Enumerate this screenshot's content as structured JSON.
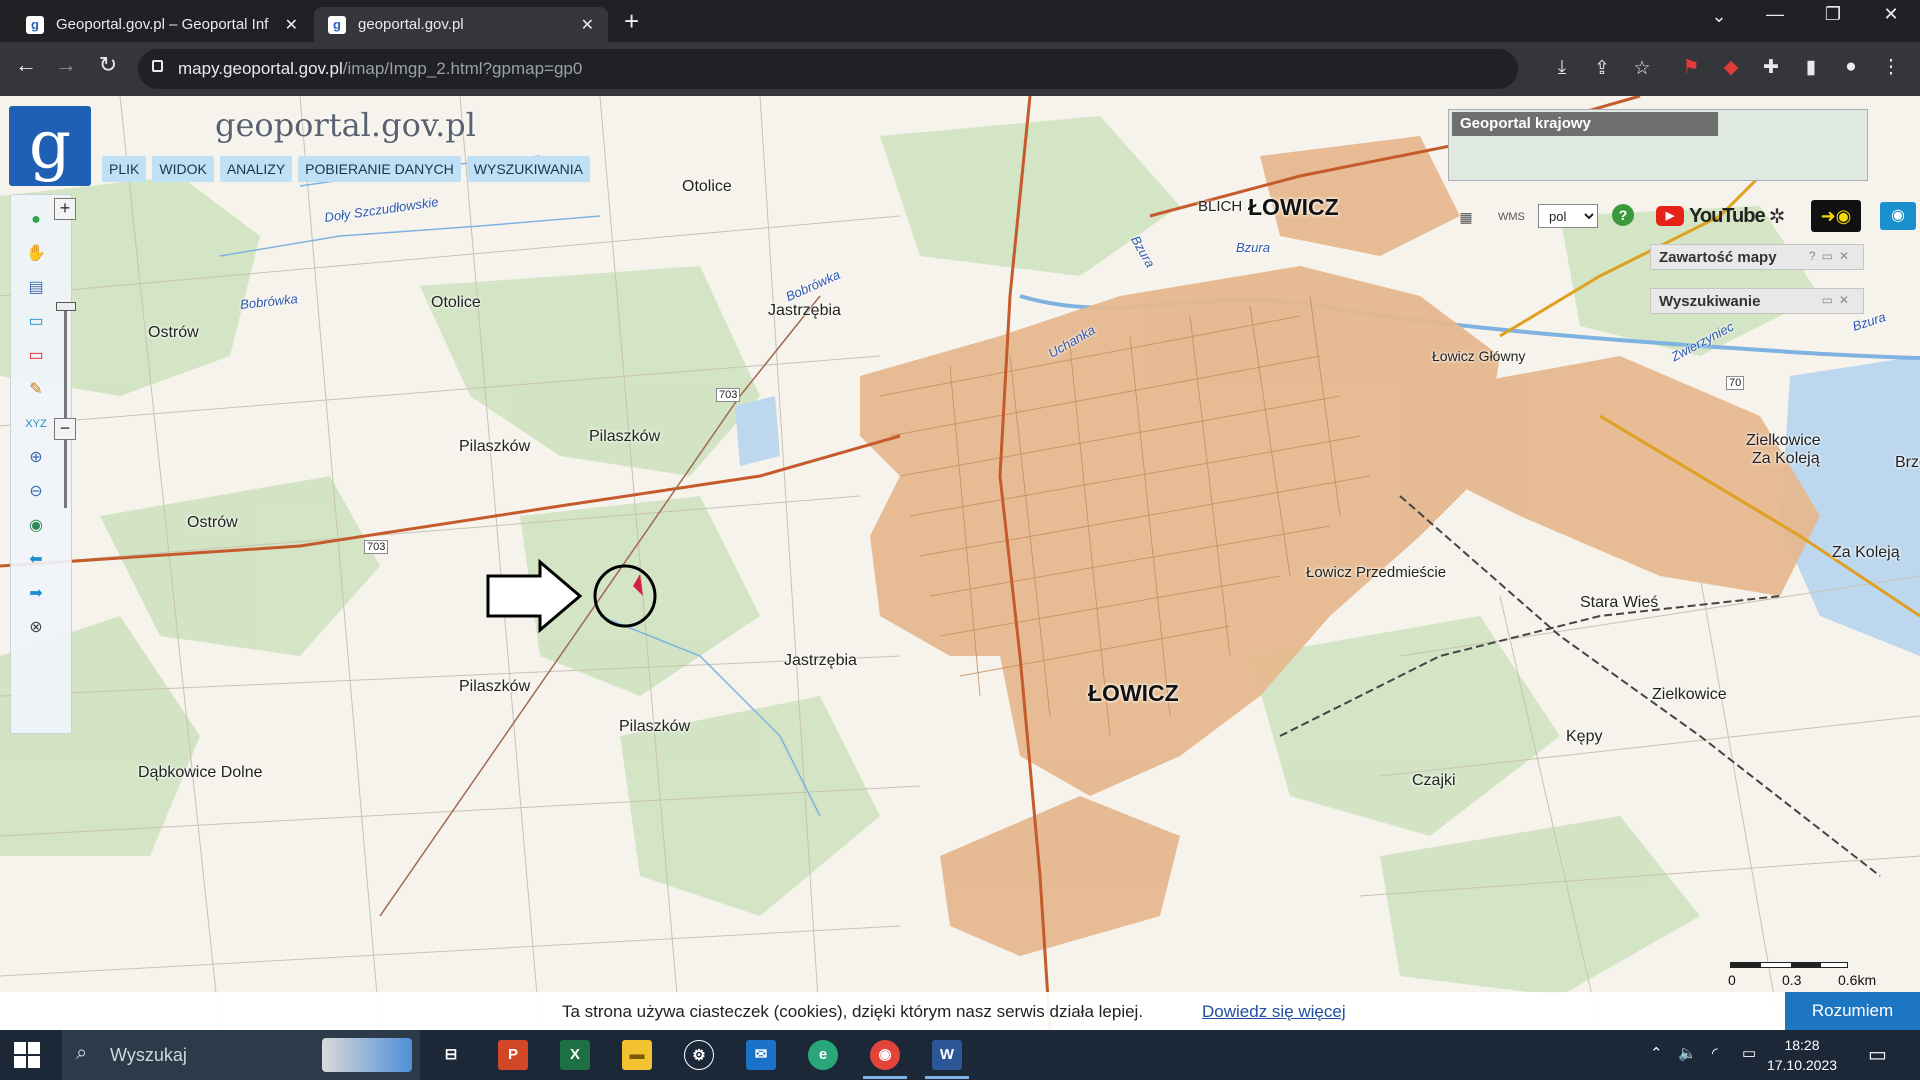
{
  "browser": {
    "tabs": [
      {
        "title": "Geoportal.gov.pl – Geoportal Inf",
        "active": false
      },
      {
        "title": "geoportal.gov.pl",
        "active": true
      }
    ],
    "url_host": "mapy.geoportal.gov.pl",
    "url_path": "/imap/Imgp_2.html?gpmap=gp0"
  },
  "geoportal": {
    "logo_letter": "g",
    "brand": "geoportal.gov.pl",
    "menu": [
      "PLIK",
      "WIDOK",
      "ANALIZY",
      "POBIERANIE DANYCH",
      "WYSZUKIWANIA"
    ],
    "overview_title": "Geoportal krajowy",
    "language": "pol",
    "youtube_label": "YouTube",
    "panels": [
      "Zawartość mapy",
      "Wyszukiwanie"
    ],
    "scale_labels": [
      "0",
      "0.3",
      "0.6km"
    ]
  },
  "map": {
    "labels": [
      {
        "text": "Otolice",
        "style": "normal"
      },
      {
        "text": "Doły Szczudłowskie",
        "style": "water"
      },
      {
        "text": "Bobrówka",
        "style": "water"
      },
      {
        "text": "Bobrówka",
        "style": "water"
      },
      {
        "text": "Otolice",
        "style": "normal"
      },
      {
        "text": "Ostrów",
        "style": "normal"
      },
      {
        "text": "Jastrzębia",
        "style": "normal"
      },
      {
        "text": "BLICH",
        "style": "normal"
      },
      {
        "text": "ŁOWICZ",
        "style": "big"
      },
      {
        "text": "Bzura",
        "style": "water"
      },
      {
        "text": "Bzura",
        "style": "water"
      },
      {
        "text": "Bzura",
        "style": "water"
      },
      {
        "text": "Łowicz Główny",
        "style": "normal"
      },
      {
        "text": "Pilaszków",
        "style": "normal"
      },
      {
        "text": "Pilaszków",
        "style": "normal"
      },
      {
        "text": "Ostrów",
        "style": "normal"
      },
      {
        "text": "Zielkowice",
        "style": "normal"
      },
      {
        "text": "Za Koleją",
        "style": "normal"
      },
      {
        "text": "Brze",
        "style": "normal"
      },
      {
        "text": "Za Koleją",
        "style": "normal"
      },
      {
        "text": "Łowicz Przedmieście",
        "style": "normal"
      },
      {
        "text": "Stara Wieś",
        "style": "normal"
      },
      {
        "text": "Jastrzębia",
        "style": "normal"
      },
      {
        "text": "ŁOWICZ",
        "style": "big"
      },
      {
        "text": "Zielkowice",
        "style": "normal"
      },
      {
        "text": "Pilaszków",
        "style": "normal"
      },
      {
        "text": "Pilaszków",
        "style": "normal"
      },
      {
        "text": "Kępy",
        "style": "normal"
      },
      {
        "text": "Dąbkowice Dolne",
        "style": "normal"
      },
      {
        "text": "Czajki",
        "style": "normal"
      },
      {
        "text": "703",
        "style": "road"
      },
      {
        "text": "703",
        "style": "road"
      },
      {
        "text": "70",
        "style": "road"
      },
      {
        "text": "Uchanka",
        "style": "water"
      },
      {
        "text": "Zwierzyniec",
        "style": "water"
      }
    ]
  },
  "cookie": {
    "text": "Ta strona używa ciasteczek (cookies), dzięki którym nasz serwis działa lepiej.",
    "link": "Dowiedz się więcej",
    "button": "Rozumiem"
  },
  "taskbar": {
    "search_placeholder": "Wyszukaj",
    "time": "18:28",
    "date": "17.10.2023"
  },
  "colors": {
    "urban": "#e6b88f",
    "forest": "#cfe3c0",
    "water": "#bcd7ee",
    "road": "#c55a2c",
    "accent": "#1d76c2"
  }
}
